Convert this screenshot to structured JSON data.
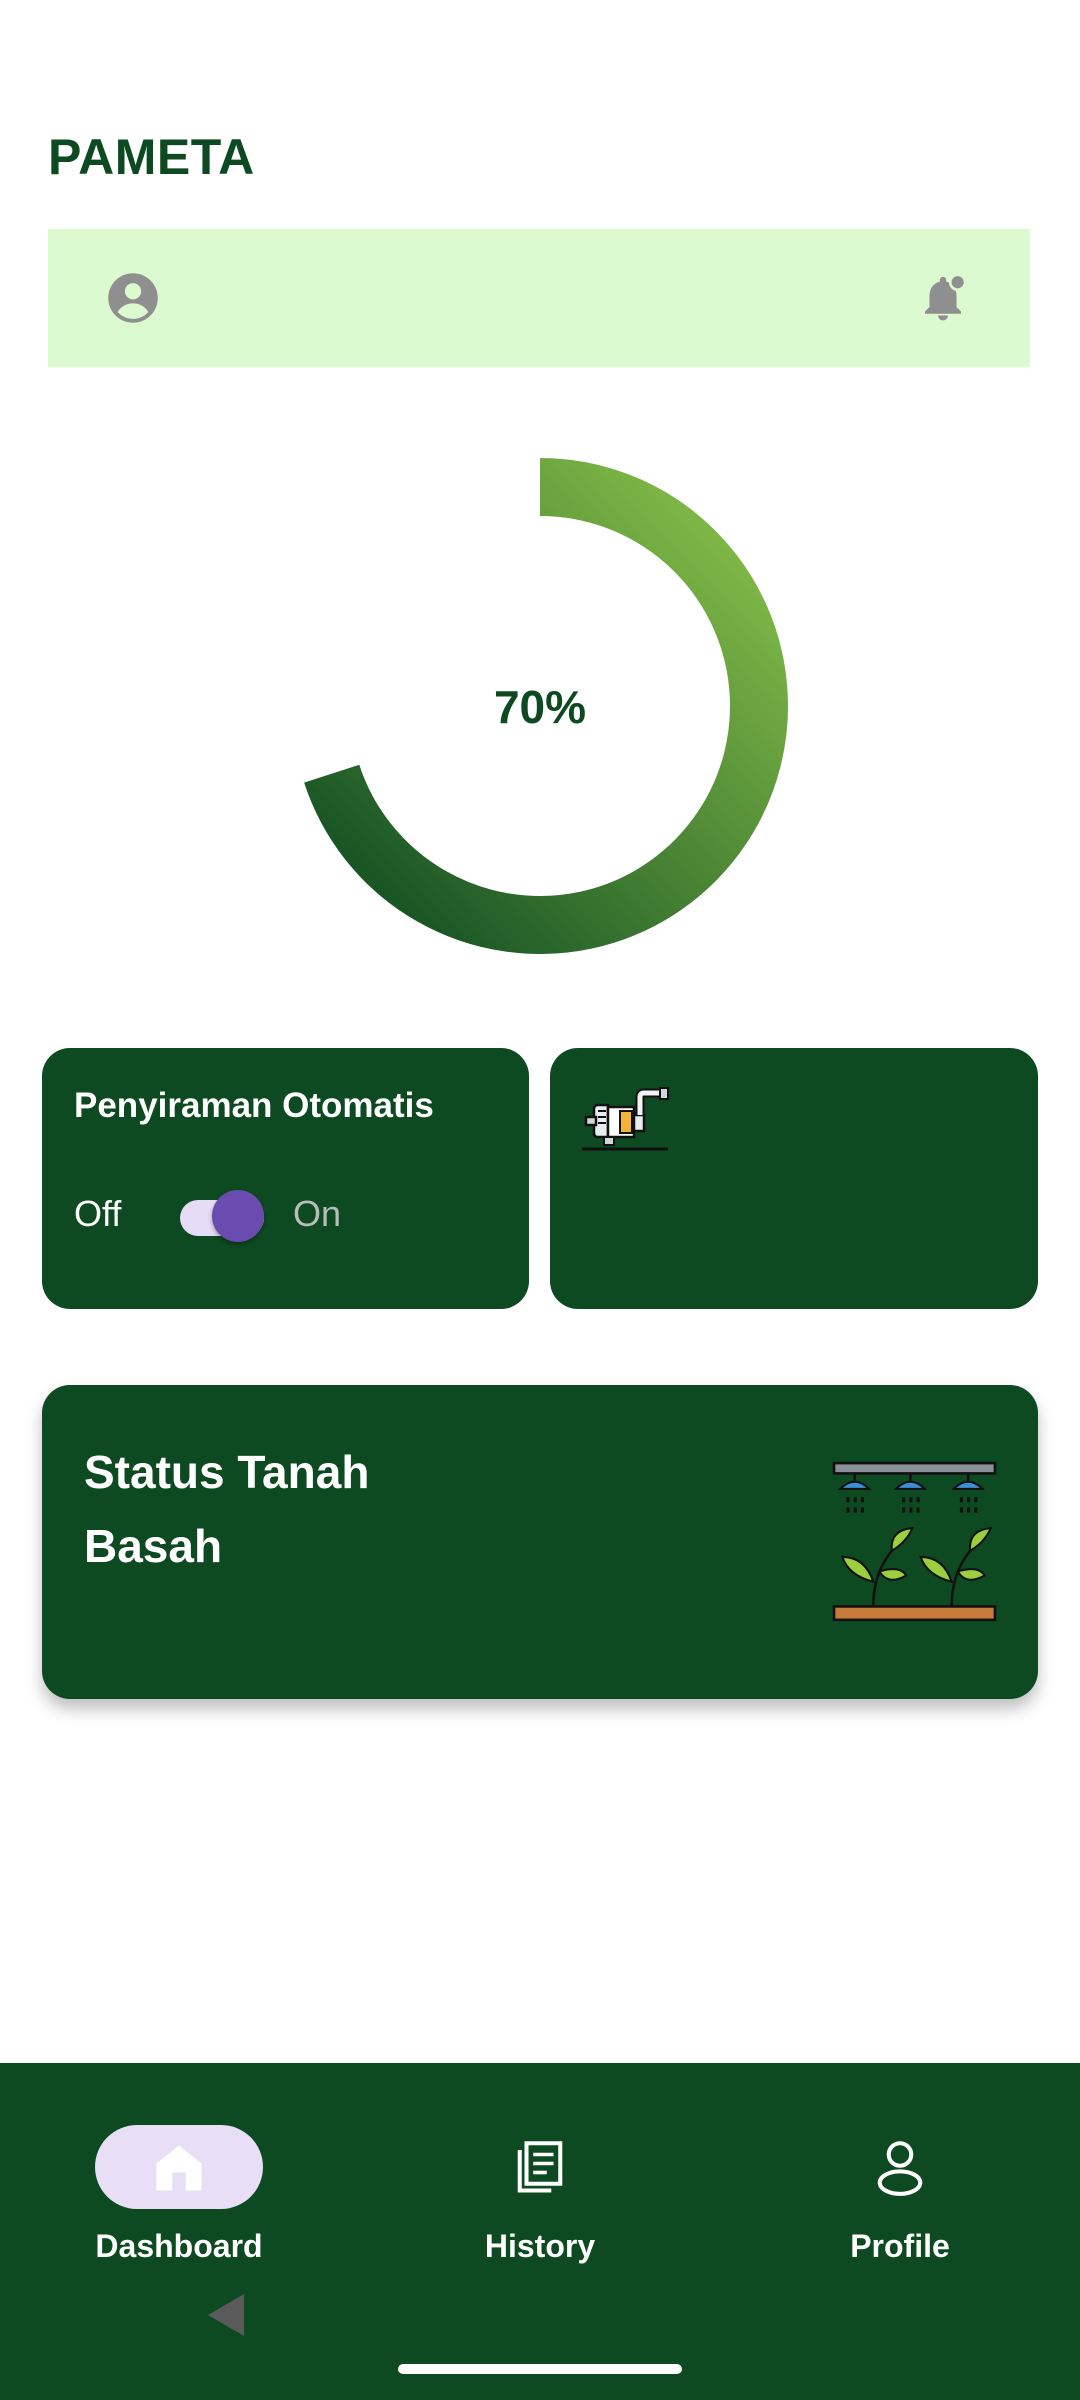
{
  "app": {
    "title": "PAMETA"
  },
  "top_bar": {
    "left_icon": "account-circle-icon",
    "right_icon": "notification-bell-icon"
  },
  "moisture": {
    "value_label": "70%",
    "percent": 70,
    "gradient_start": "#8bc34a",
    "gradient_end": "#0d4a21"
  },
  "auto_watering": {
    "title": "Penyiraman Otomatis",
    "off_label": "Off",
    "on_label": "On",
    "enabled": true
  },
  "pump": {
    "icon": "water-pump-icon"
  },
  "status": {
    "title_line1": "Status Tanah",
    "title_line2": "Basah",
    "icon": "irrigation-plants-icon"
  },
  "nav": {
    "items": [
      {
        "label": "Dashboard",
        "icon": "home-icon",
        "active": true
      },
      {
        "label": "History",
        "icon": "documents-icon",
        "active": false
      },
      {
        "label": "Profile",
        "icon": "person-icon",
        "active": false
      }
    ]
  },
  "colors": {
    "primary": "#0d4a21",
    "top_bar_bg": "#dbfad0",
    "toggle_thumb": "#6a4cb0",
    "nav_pill": "#e8dff7"
  }
}
